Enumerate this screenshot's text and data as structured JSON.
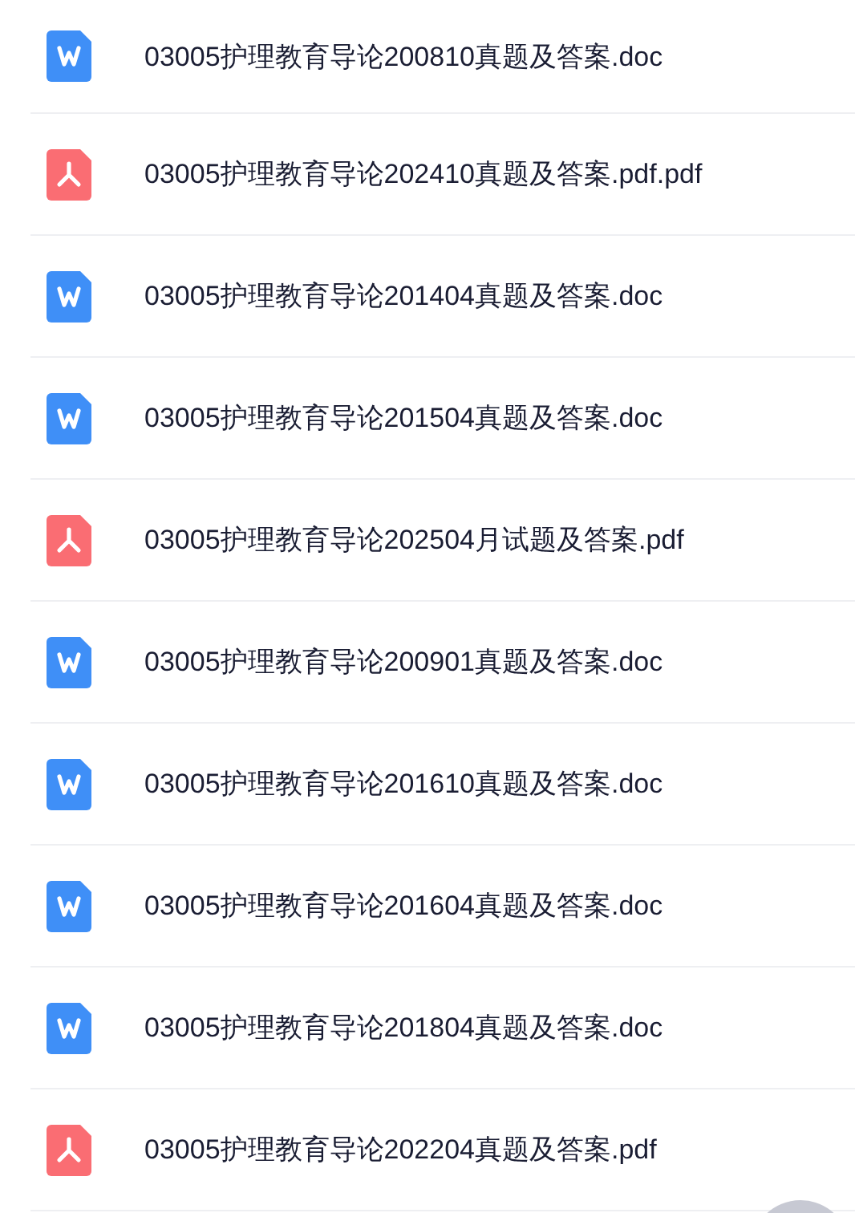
{
  "files": [
    {
      "name": "03005护理教育导论200810真题及答案.doc",
      "kind": "word"
    },
    {
      "name": "03005护理教育导论202410真题及答案.pdf.pdf",
      "kind": "pdf"
    },
    {
      "name": "03005护理教育导论201404真题及答案.doc",
      "kind": "word"
    },
    {
      "name": "03005护理教育导论201504真题及答案.doc",
      "kind": "word"
    },
    {
      "name": "03005护理教育导论202504月试题及答案.pdf",
      "kind": "pdf"
    },
    {
      "name": "03005护理教育导论200901真题及答案.doc",
      "kind": "word"
    },
    {
      "name": "03005护理教育导论201610真题及答案.doc",
      "kind": "word"
    },
    {
      "name": "03005护理教育导论201604真题及答案.doc",
      "kind": "word"
    },
    {
      "name": "03005护理教育导论201804真题及答案.doc",
      "kind": "word"
    },
    {
      "name": "03005护理教育导论202204真题及答案.pdf",
      "kind": "pdf"
    }
  ]
}
